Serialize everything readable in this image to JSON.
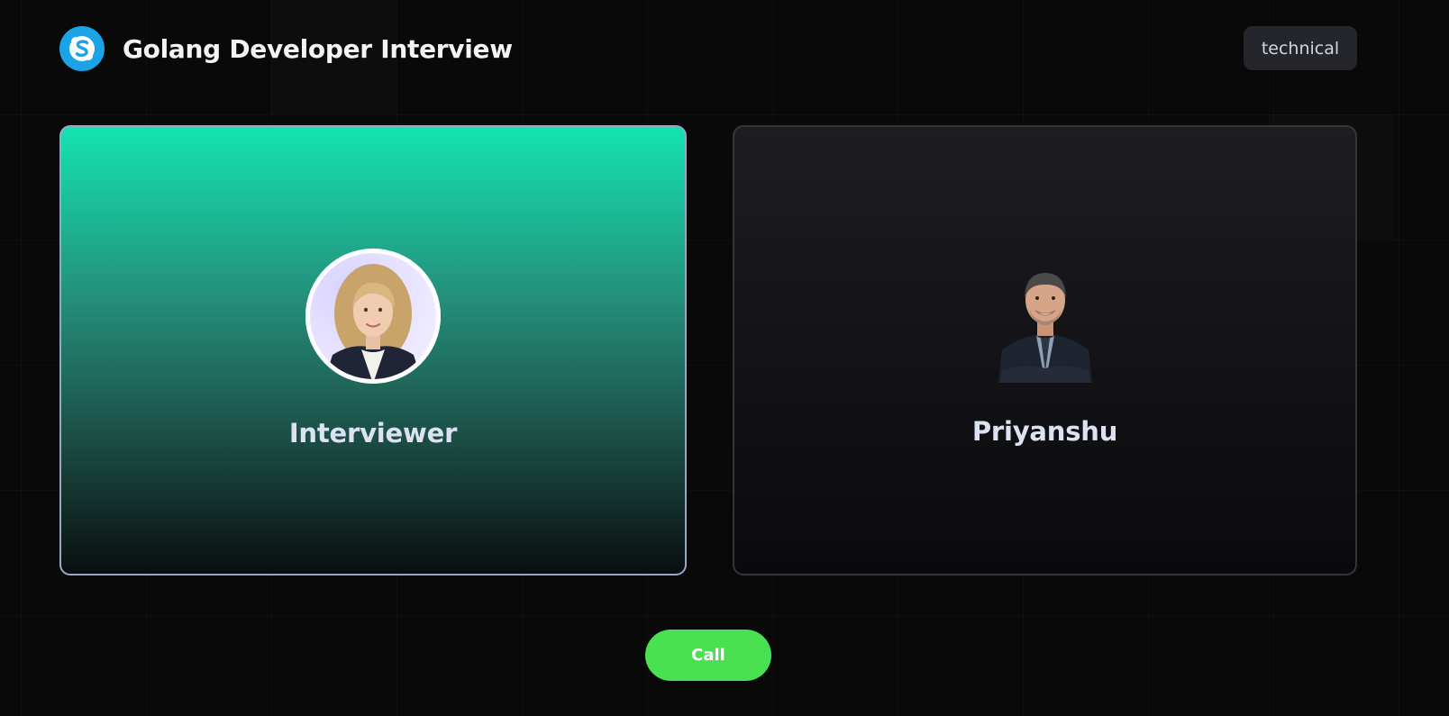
{
  "header": {
    "title": "Golang Developer Interview",
    "logo_icon": "skype-icon",
    "type_tag": "technical"
  },
  "cards": {
    "interviewer": {
      "name": "Interviewer",
      "avatar": "woman-portrait-avatar"
    },
    "candidate": {
      "name": "Priyanshu",
      "avatar": "man-portrait-avatar"
    }
  },
  "actions": {
    "call_label": "Call"
  },
  "colors": {
    "background": "#09090a",
    "accent_teal": "#14e3b2",
    "call_green": "#49e052",
    "logo_blue": "#1aa3e8"
  }
}
